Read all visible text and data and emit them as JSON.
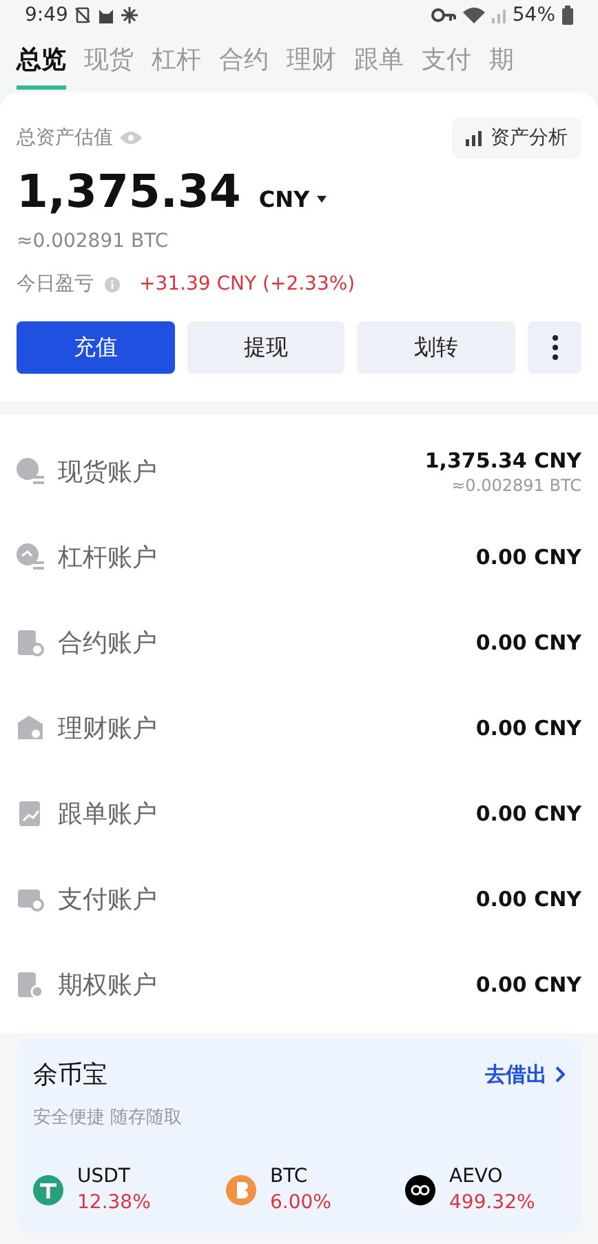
{
  "status_bar": {
    "time": "9:49",
    "battery": "54%"
  },
  "tabs": [
    {
      "label": "总览",
      "selected": true
    },
    {
      "label": "现货",
      "selected": false
    },
    {
      "label": "杠杆",
      "selected": false
    },
    {
      "label": "合约",
      "selected": false
    },
    {
      "label": "理财",
      "selected": false
    },
    {
      "label": "跟单",
      "selected": false
    },
    {
      "label": "支付",
      "selected": false
    },
    {
      "label": "期",
      "selected": false
    }
  ],
  "summary": {
    "title": "总资产估值",
    "analysis_button": "资产分析",
    "total": "1,375.34",
    "currency": "CNY",
    "btc_equiv": "≈0.002891 BTC",
    "pnl_label": "今日盈亏",
    "pnl_value": "+31.39 CNY (+2.33%)"
  },
  "actions": [
    {
      "label": "充值",
      "kind": "primary"
    },
    {
      "label": "提现",
      "kind": "secondary"
    },
    {
      "label": "划转",
      "kind": "secondary"
    },
    {
      "kind": "more"
    }
  ],
  "accounts": [
    {
      "name": "现货账户",
      "kind": "spot",
      "value": "1,375.34 CNY",
      "sub": "≈0.002891 BTC"
    },
    {
      "name": "杠杆账户",
      "kind": "margin",
      "value": "0.00 CNY"
    },
    {
      "name": "合约账户",
      "kind": "futures",
      "value": "0.00 CNY"
    },
    {
      "name": "理财账户",
      "kind": "earn",
      "value": "0.00 CNY"
    },
    {
      "name": "跟单账户",
      "kind": "copy",
      "value": "0.00 CNY"
    },
    {
      "name": "支付账户",
      "kind": "pay",
      "value": "0.00 CNY"
    },
    {
      "name": "期权账户",
      "kind": "options",
      "value": "0.00 CNY"
    }
  ],
  "savings": {
    "title": "余币宝",
    "link": "去借出",
    "subtitle": "安全便捷 随存随取",
    "coins": [
      {
        "symbol": "USDT",
        "rate": "12.38%",
        "color": "#26a17b",
        "kind": "tether"
      },
      {
        "symbol": "BTC",
        "rate": "6.00%",
        "color": "#f09242",
        "kind": "bitcoin"
      },
      {
        "symbol": "AEVO",
        "rate": "499.32%",
        "color": "#000000",
        "kind": "aevo"
      }
    ]
  }
}
